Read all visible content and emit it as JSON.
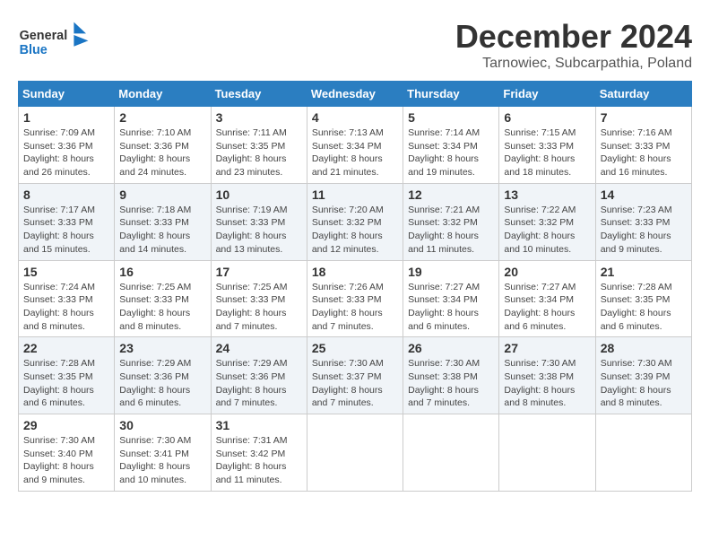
{
  "header": {
    "logo_general": "General",
    "logo_blue": "Blue",
    "month_title": "December 2024",
    "location": "Tarnowiec, Subcarpathia, Poland"
  },
  "weekdays": [
    "Sunday",
    "Monday",
    "Tuesday",
    "Wednesday",
    "Thursday",
    "Friday",
    "Saturday"
  ],
  "weeks": [
    [
      {
        "day": "1",
        "sunrise": "Sunrise: 7:09 AM",
        "sunset": "Sunset: 3:36 PM",
        "daylight": "Daylight: 8 hours and 26 minutes."
      },
      {
        "day": "2",
        "sunrise": "Sunrise: 7:10 AM",
        "sunset": "Sunset: 3:36 PM",
        "daylight": "Daylight: 8 hours and 24 minutes."
      },
      {
        "day": "3",
        "sunrise": "Sunrise: 7:11 AM",
        "sunset": "Sunset: 3:35 PM",
        "daylight": "Daylight: 8 hours and 23 minutes."
      },
      {
        "day": "4",
        "sunrise": "Sunrise: 7:13 AM",
        "sunset": "Sunset: 3:34 PM",
        "daylight": "Daylight: 8 hours and 21 minutes."
      },
      {
        "day": "5",
        "sunrise": "Sunrise: 7:14 AM",
        "sunset": "Sunset: 3:34 PM",
        "daylight": "Daylight: 8 hours and 19 minutes."
      },
      {
        "day": "6",
        "sunrise": "Sunrise: 7:15 AM",
        "sunset": "Sunset: 3:33 PM",
        "daylight": "Daylight: 8 hours and 18 minutes."
      },
      {
        "day": "7",
        "sunrise": "Sunrise: 7:16 AM",
        "sunset": "Sunset: 3:33 PM",
        "daylight": "Daylight: 8 hours and 16 minutes."
      }
    ],
    [
      {
        "day": "8",
        "sunrise": "Sunrise: 7:17 AM",
        "sunset": "Sunset: 3:33 PM",
        "daylight": "Daylight: 8 hours and 15 minutes."
      },
      {
        "day": "9",
        "sunrise": "Sunrise: 7:18 AM",
        "sunset": "Sunset: 3:33 PM",
        "daylight": "Daylight: 8 hours and 14 minutes."
      },
      {
        "day": "10",
        "sunrise": "Sunrise: 7:19 AM",
        "sunset": "Sunset: 3:33 PM",
        "daylight": "Daylight: 8 hours and 13 minutes."
      },
      {
        "day": "11",
        "sunrise": "Sunrise: 7:20 AM",
        "sunset": "Sunset: 3:32 PM",
        "daylight": "Daylight: 8 hours and 12 minutes."
      },
      {
        "day": "12",
        "sunrise": "Sunrise: 7:21 AM",
        "sunset": "Sunset: 3:32 PM",
        "daylight": "Daylight: 8 hours and 11 minutes."
      },
      {
        "day": "13",
        "sunrise": "Sunrise: 7:22 AM",
        "sunset": "Sunset: 3:32 PM",
        "daylight": "Daylight: 8 hours and 10 minutes."
      },
      {
        "day": "14",
        "sunrise": "Sunrise: 7:23 AM",
        "sunset": "Sunset: 3:33 PM",
        "daylight": "Daylight: 8 hours and 9 minutes."
      }
    ],
    [
      {
        "day": "15",
        "sunrise": "Sunrise: 7:24 AM",
        "sunset": "Sunset: 3:33 PM",
        "daylight": "Daylight: 8 hours and 8 minutes."
      },
      {
        "day": "16",
        "sunrise": "Sunrise: 7:25 AM",
        "sunset": "Sunset: 3:33 PM",
        "daylight": "Daylight: 8 hours and 8 minutes."
      },
      {
        "day": "17",
        "sunrise": "Sunrise: 7:25 AM",
        "sunset": "Sunset: 3:33 PM",
        "daylight": "Daylight: 8 hours and 7 minutes."
      },
      {
        "day": "18",
        "sunrise": "Sunrise: 7:26 AM",
        "sunset": "Sunset: 3:33 PM",
        "daylight": "Daylight: 8 hours and 7 minutes."
      },
      {
        "day": "19",
        "sunrise": "Sunrise: 7:27 AM",
        "sunset": "Sunset: 3:34 PM",
        "daylight": "Daylight: 8 hours and 6 minutes."
      },
      {
        "day": "20",
        "sunrise": "Sunrise: 7:27 AM",
        "sunset": "Sunset: 3:34 PM",
        "daylight": "Daylight: 8 hours and 6 minutes."
      },
      {
        "day": "21",
        "sunrise": "Sunrise: 7:28 AM",
        "sunset": "Sunset: 3:35 PM",
        "daylight": "Daylight: 8 hours and 6 minutes."
      }
    ],
    [
      {
        "day": "22",
        "sunrise": "Sunrise: 7:28 AM",
        "sunset": "Sunset: 3:35 PM",
        "daylight": "Daylight: 8 hours and 6 minutes."
      },
      {
        "day": "23",
        "sunrise": "Sunrise: 7:29 AM",
        "sunset": "Sunset: 3:36 PM",
        "daylight": "Daylight: 8 hours and 6 minutes."
      },
      {
        "day": "24",
        "sunrise": "Sunrise: 7:29 AM",
        "sunset": "Sunset: 3:36 PM",
        "daylight": "Daylight: 8 hours and 7 minutes."
      },
      {
        "day": "25",
        "sunrise": "Sunrise: 7:30 AM",
        "sunset": "Sunset: 3:37 PM",
        "daylight": "Daylight: 8 hours and 7 minutes."
      },
      {
        "day": "26",
        "sunrise": "Sunrise: 7:30 AM",
        "sunset": "Sunset: 3:38 PM",
        "daylight": "Daylight: 8 hours and 7 minutes."
      },
      {
        "day": "27",
        "sunrise": "Sunrise: 7:30 AM",
        "sunset": "Sunset: 3:38 PM",
        "daylight": "Daylight: 8 hours and 8 minutes."
      },
      {
        "day": "28",
        "sunrise": "Sunrise: 7:30 AM",
        "sunset": "Sunset: 3:39 PM",
        "daylight": "Daylight: 8 hours and 8 minutes."
      }
    ],
    [
      {
        "day": "29",
        "sunrise": "Sunrise: 7:30 AM",
        "sunset": "Sunset: 3:40 PM",
        "daylight": "Daylight: 8 hours and 9 minutes."
      },
      {
        "day": "30",
        "sunrise": "Sunrise: 7:30 AM",
        "sunset": "Sunset: 3:41 PM",
        "daylight": "Daylight: 8 hours and 10 minutes."
      },
      {
        "day": "31",
        "sunrise": "Sunrise: 7:31 AM",
        "sunset": "Sunset: 3:42 PM",
        "daylight": "Daylight: 8 hours and 11 minutes."
      },
      null,
      null,
      null,
      null
    ]
  ]
}
